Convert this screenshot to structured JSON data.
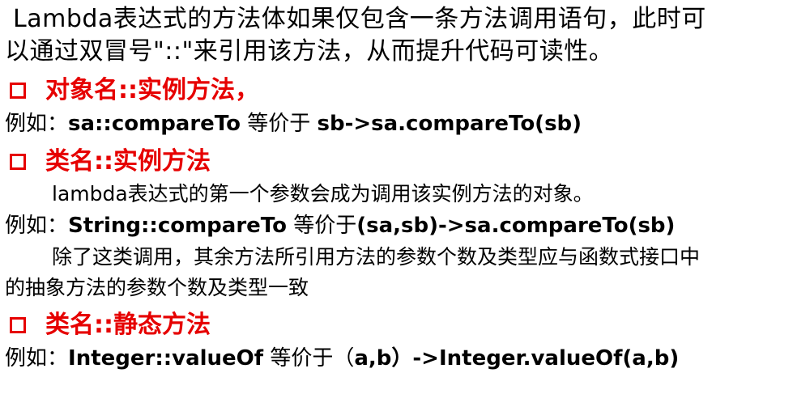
{
  "intro": {
    "line1": "Lambda表达式的方法体如果仅包含一条方法调用语句，此时可",
    "line2": "以通过双冒号\"::\"来引用该方法，从而提升代码可读性。"
  },
  "sections": [
    {
      "heading": "对象名::实例方法，",
      "example_prefix": "例如：",
      "example_left": "sa::compareTo",
      "example_mid": " 等价于 ",
      "example_right": "sb->sa.compareTo(sb)"
    },
    {
      "heading": "类名::实例方法",
      "note1": "lambda表达式的第一个参数会成为调用该实例方法的对象。",
      "example_prefix": "例如：",
      "example_left": "String::compareTo",
      "example_mid": " 等价于",
      "example_right": "(sa,sb)->sa.compareTo(sb)",
      "note2_line1": "除了这类调用，其余方法所引用方法的参数个数及类型应与函数式接口中",
      "note2_line2": "的抽象方法的参数个数及类型一致"
    },
    {
      "heading": "类名::静态方法",
      "example_prefix": "例如：",
      "example_left": "Integer::valueOf",
      "example_mid": " 等价于（",
      "example_right": "a,b）->Integer.valueOf(a,b)"
    }
  ],
  "colors": {
    "heading": "#e60000",
    "text": "#000000"
  }
}
